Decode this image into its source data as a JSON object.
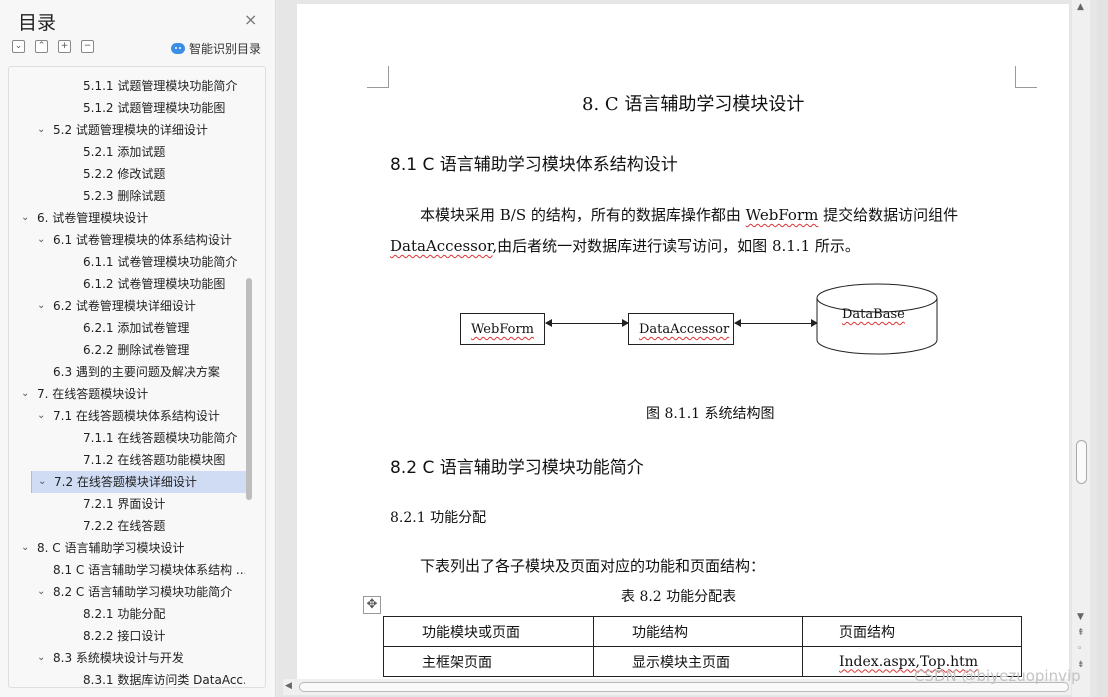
{
  "sidebar": {
    "title": "目录",
    "close": "×",
    "tools": [
      "⌄",
      "⌃",
      "+",
      "−"
    ],
    "smart_label": "智能识别目录",
    "toc": [
      {
        "label": "5.1.1  试题管理模块功能简介",
        "level": 3,
        "chev": ""
      },
      {
        "label": "5.1.2  试题管理模块功能图",
        "level": 3,
        "chev": ""
      },
      {
        "label": "5.2  试题管理模块的详细设计",
        "level": 2,
        "chev": "⌄"
      },
      {
        "label": "5.2.1  添加试题",
        "level": 3,
        "chev": ""
      },
      {
        "label": "5.2.2  修改试题",
        "level": 3,
        "chev": ""
      },
      {
        "label": "5.2.3  删除试题",
        "level": 3,
        "chev": ""
      },
      {
        "label": "6.  试卷管理模块设计",
        "level": 1,
        "chev": "⌄"
      },
      {
        "label": "6.1 试卷管理模块的体系结构设计",
        "level": 2,
        "chev": "⌄"
      },
      {
        "label": "6.1.1  试卷管理模块功能简介",
        "level": 3,
        "chev": ""
      },
      {
        "label": "6.1.2  试卷管理模块功能图",
        "level": 3,
        "chev": ""
      },
      {
        "label": "6.2  试卷管理模块详细设计",
        "level": 2,
        "chev": "⌄"
      },
      {
        "label": "6.2.1  添加试卷管理",
        "level": 3,
        "chev": ""
      },
      {
        "label": "6.2.2  删除试卷管理",
        "level": 3,
        "chev": ""
      },
      {
        "label": "6.3  遇到的主要问题及解决方案",
        "level": 2,
        "chev": ""
      },
      {
        "label": "7.  在线答题模块设计",
        "level": 1,
        "chev": "⌄"
      },
      {
        "label": "7.1  在线答题模块体系结构设计",
        "level": 2,
        "chev": "⌄"
      },
      {
        "label": "7.1.1  在线答题模块功能简介",
        "level": 3,
        "chev": ""
      },
      {
        "label": "7.1.2  在线答题功能模块图",
        "level": 3,
        "chev": ""
      },
      {
        "label": "7.2  在线答题模块详细设计",
        "level": 2,
        "chev": "⌄",
        "selected": true
      },
      {
        "label": "7.2.1  界面设计",
        "level": 3,
        "chev": ""
      },
      {
        "label": "7.2.2  在线答题",
        "level": 3,
        "chev": ""
      },
      {
        "label": "8. C 语言辅助学习模块设计",
        "level": 1,
        "chev": "⌄"
      },
      {
        "label": "8.1 C 语言辅助学习模块体系结构 ...",
        "level": 2,
        "chev": ""
      },
      {
        "label": "8.2 C 语言辅助学习模块功能简介",
        "level": 2,
        "chev": "⌄"
      },
      {
        "label": "8.2.1  功能分配",
        "level": 3,
        "chev": ""
      },
      {
        "label": "8.2.2  接口设计",
        "level": 3,
        "chev": ""
      },
      {
        "label": "8.3  系统模块设计与开发",
        "level": 2,
        "chev": "⌄"
      },
      {
        "label": "8.3.1  数据库访问类 DataAcc...",
        "level": 3,
        "chev": ""
      }
    ]
  },
  "doc": {
    "chapter_title": "8. C 语言辅助学习模块设计",
    "section1_title": "8.1 C 语言辅助学习模块体系结构设计",
    "para1_a": "本模块采用 B/S 的结构，所有的数据库操作都由 ",
    "para1_w1": "WebForm",
    "para1_b": " 提交给数据访问组件",
    "para1_w2": "DataAccessor",
    "para1_c": ",由后者统一对数据库进行读写访问，如图 8.1.1 所示。",
    "diagram": {
      "box1": "WebForm",
      "box2": "DataAccessor",
      "box3": "DataBase"
    },
    "figure_caption": "图 8.1.1  系统结构图",
    "section2_title": "8.2 C 语言辅助学习模块功能简介",
    "sub_title": "8.2.1  功能分配",
    "para2": "下表列出了各子模块及页面对应的功能和页面结构：",
    "table_caption": "表 8.2  功能分配表",
    "table": {
      "headers": [
        "功能模块或页面",
        "功能结构",
        "页面结构"
      ],
      "row1": [
        "主框架页面",
        "显示模块主页面",
        "Index.aspx,Top.htm"
      ]
    }
  },
  "scroll": {
    "up": "▲",
    "down": "▼",
    "left": "◀"
  },
  "watermark": "CSDN @biyezuopinvip"
}
